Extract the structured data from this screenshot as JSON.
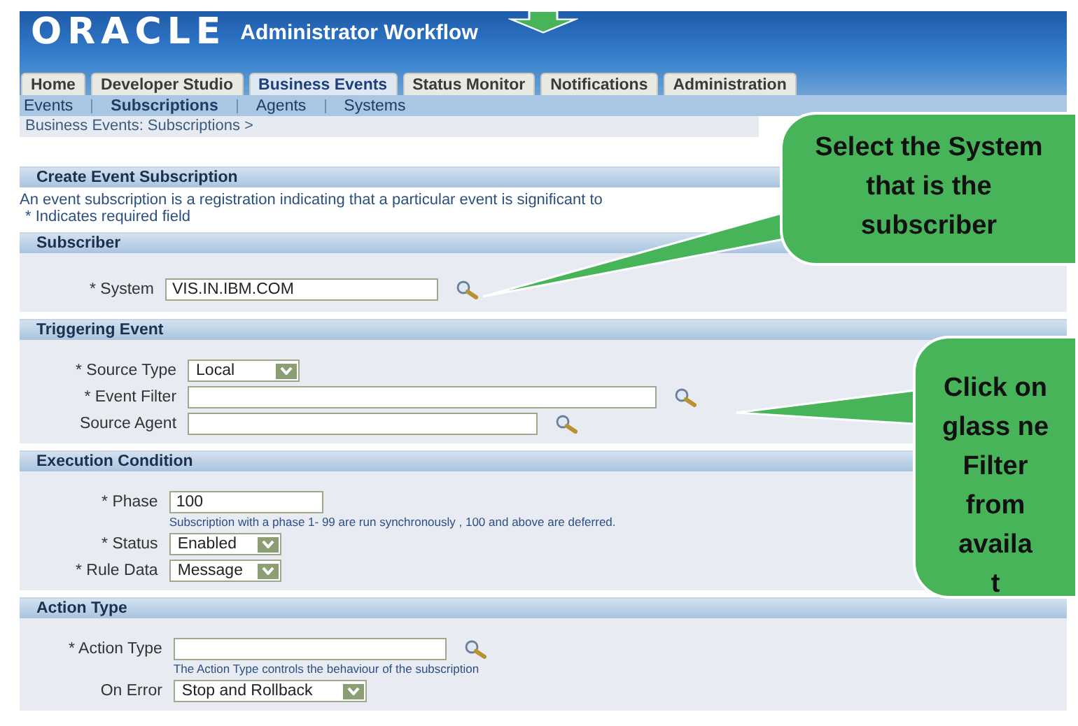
{
  "header": {
    "logo": "ORACLE",
    "title": "Administrator Workflow"
  },
  "tabs": [
    {
      "label": "Home",
      "selected": false
    },
    {
      "label": "Developer Studio",
      "selected": false
    },
    {
      "label": "Business Events",
      "selected": true
    },
    {
      "label": "Status Monitor",
      "selected": false
    },
    {
      "label": "Notifications",
      "selected": false
    },
    {
      "label": "Administration",
      "selected": false
    }
  ],
  "subnav": [
    {
      "label": "Events",
      "selected": false
    },
    {
      "label": "Subscriptions",
      "selected": true
    },
    {
      "label": "Agents",
      "selected": false
    },
    {
      "label": "Systems",
      "selected": false
    }
  ],
  "breadcrumb": "Business Events: Subscriptions >",
  "page": {
    "title": "Create Event Subscription",
    "description": "An event subscription is a registration indicating that a particular event is significant to",
    "required_note": "* Indicates required field"
  },
  "sections": [
    {
      "title": "Subscriber",
      "fields": [
        {
          "kind": "text",
          "label": "* System",
          "value": "VIS.IN.IBM.COM",
          "lookup": true
        }
      ]
    },
    {
      "title": "Triggering Event",
      "fields": [
        {
          "kind": "select",
          "label": "* Source Type",
          "value": "Local"
        },
        {
          "kind": "text",
          "label": "* Event Filter",
          "lookup": true
        },
        {
          "kind": "text",
          "label": "Source Agent",
          "lookup": true
        }
      ]
    },
    {
      "title": "Execution Condition",
      "fields": [
        {
          "kind": "text",
          "label": "* Phase",
          "value": "100",
          "lookup": false,
          "hint": "Subscription with a phase 1- 99 are run synchronously , 100 and above are deferred."
        },
        {
          "kind": "select",
          "label": "* Status",
          "value": "Enabled"
        },
        {
          "kind": "select",
          "label": "* Rule Data",
          "value": "Message"
        }
      ]
    },
    {
      "title": "Action Type",
      "fields": [
        {
          "kind": "text",
          "label": "* Action Type",
          "lookup": true,
          "hint": "The Action Type controls the behaviour of the subscription"
        },
        {
          "kind": "select",
          "label": "On Error",
          "value": "Stop and Rollback"
        }
      ]
    }
  ],
  "callouts": [
    {
      "lines": [
        "Select the System",
        "that is the",
        "subscriber"
      ]
    },
    {
      "lines": [
        "Click on",
        "glass ne",
        "Filter",
        "from",
        "availa",
        "t"
      ]
    }
  ]
}
